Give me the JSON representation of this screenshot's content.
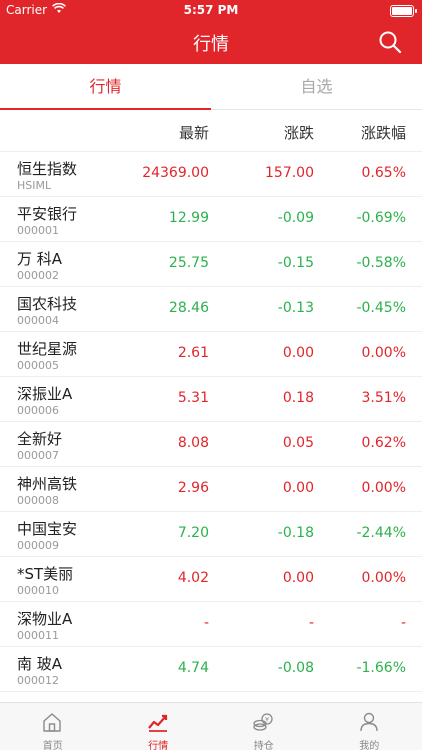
{
  "status_bar": {
    "carrier": "Carrier",
    "time": "5:57 PM"
  },
  "nav": {
    "title": "行情"
  },
  "tabs": [
    {
      "label": "行情",
      "active": true
    },
    {
      "label": "自选",
      "active": false
    }
  ],
  "columns": {
    "latest": "最新",
    "change": "涨跌",
    "change_pct": "涨跌幅"
  },
  "rows": [
    {
      "name": "恒生指数",
      "code": "HSIML",
      "latest": "24369.00",
      "change": "157.00",
      "pct": "0.65%",
      "color": "red"
    },
    {
      "name": "平安银行",
      "code": "000001",
      "latest": "12.99",
      "change": "-0.09",
      "pct": "-0.69%",
      "color": "green"
    },
    {
      "name": "万 科A",
      "code": "000002",
      "latest": "25.75",
      "change": "-0.15",
      "pct": "-0.58%",
      "color": "green"
    },
    {
      "name": "国农科技",
      "code": "000004",
      "latest": "28.46",
      "change": "-0.13",
      "pct": "-0.45%",
      "color": "green"
    },
    {
      "name": "世纪星源",
      "code": "000005",
      "latest": "2.61",
      "change": "0.00",
      "pct": "0.00%",
      "color": "red"
    },
    {
      "name": "深振业A",
      "code": "000006",
      "latest": "5.31",
      "change": "0.18",
      "pct": "3.51%",
      "color": "red"
    },
    {
      "name": "全新好",
      "code": "000007",
      "latest": "8.08",
      "change": "0.05",
      "pct": "0.62%",
      "color": "red"
    },
    {
      "name": "神州高铁",
      "code": "000008",
      "latest": "2.96",
      "change": "0.00",
      "pct": "0.00%",
      "color": "red"
    },
    {
      "name": "中国宝安",
      "code": "000009",
      "latest": "7.20",
      "change": "-0.18",
      "pct": "-2.44%",
      "color": "green"
    },
    {
      "name": "*ST美丽",
      "code": "000010",
      "latest": "4.02",
      "change": "0.00",
      "pct": "0.00%",
      "color": "red"
    },
    {
      "name": "深物业A",
      "code": "000011",
      "latest": "-",
      "change": "-",
      "pct": "-",
      "color": "red"
    },
    {
      "name": "南 玻A",
      "code": "000012",
      "latest": "4.74",
      "change": "-0.08",
      "pct": "-1.66%",
      "color": "green"
    }
  ],
  "tabbar": [
    {
      "label": "首页",
      "icon": "home-icon",
      "active": false
    },
    {
      "label": "行情",
      "icon": "market-chart-icon",
      "active": true
    },
    {
      "label": "持仓",
      "icon": "coins-icon",
      "active": false
    },
    {
      "label": "我的",
      "icon": "user-icon",
      "active": false
    }
  ],
  "colors": {
    "brand": "#e0262a",
    "up": "#e0262a",
    "down": "#2bb24c"
  }
}
